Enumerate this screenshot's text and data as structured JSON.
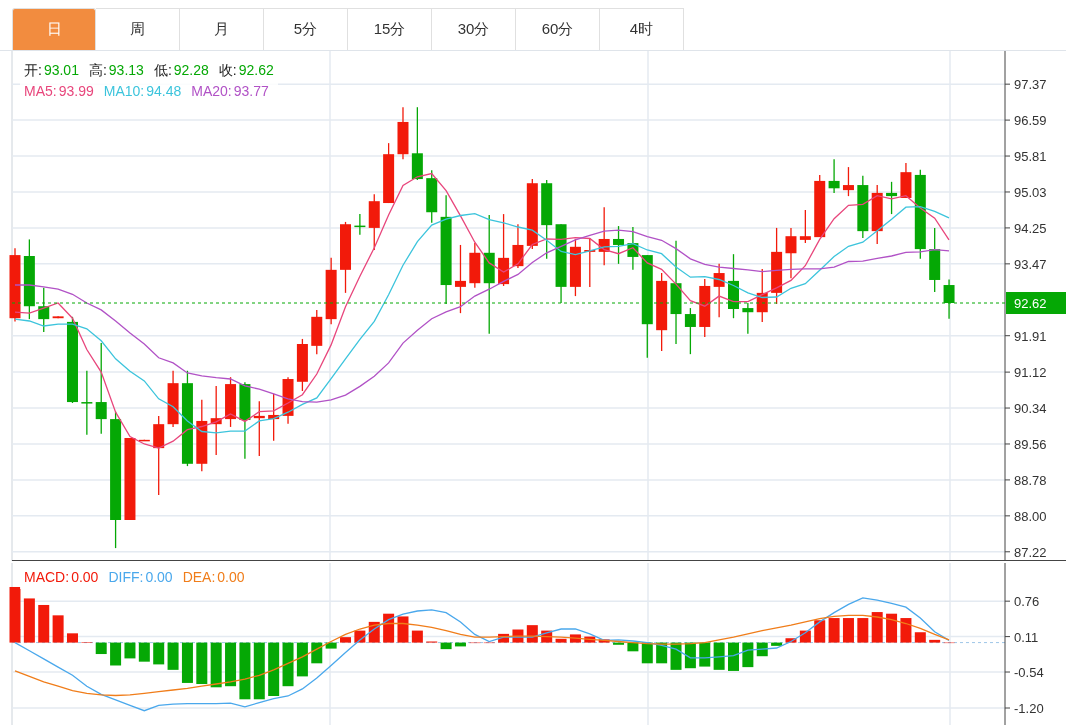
{
  "tabs": [
    {
      "label": "日",
      "selected": true
    },
    {
      "label": "周",
      "selected": false
    },
    {
      "label": "月",
      "selected": false
    },
    {
      "label": "5分",
      "selected": false
    },
    {
      "label": "15分",
      "selected": false
    },
    {
      "label": "30分",
      "selected": false
    },
    {
      "label": "60分",
      "selected": false
    },
    {
      "label": "4时",
      "selected": false
    }
  ],
  "price_chart": {
    "ohlc_legend": [
      {
        "label": "开:",
        "value": "93.01"
      },
      {
        "label": "高:",
        "value": "93.13"
      },
      {
        "label": "低:",
        "value": "92.28"
      },
      {
        "label": "收:",
        "value": "92.62"
      }
    ],
    "ma_legend": [
      {
        "separator": ":",
        "value": "93.99"
      },
      {
        "separator": ":",
        "value": "94.48"
      },
      {
        "separator": ":",
        "value": "93.77"
      }
    ],
    "chart_data": {
      "type": "candlestick",
      "ylim": [
        87.02,
        98.09
      ],
      "grid": true,
      "ref_lines": [
        {
          "axis": "y",
          "value": 92.62,
          "color": "#05a805",
          "label": "92.62"
        }
      ],
      "yticks": [
        {
          "value": 97.37,
          "label": "97.37"
        },
        {
          "value": 96.59,
          "label": "96.59"
        },
        {
          "value": 95.81,
          "label": "95.81"
        },
        {
          "value": 95.03,
          "label": "95.03"
        },
        {
          "value": 94.25,
          "label": "94.25"
        },
        {
          "value": 93.47,
          "label": "93.47"
        },
        {
          "value": 91.91,
          "label": "91.91"
        },
        {
          "value": 91.12,
          "label": "91.12"
        },
        {
          "value": 90.34,
          "label": "90.34"
        },
        {
          "value": 89.56,
          "label": "89.56"
        },
        {
          "value": 88.78,
          "label": "88.78"
        },
        {
          "value": 88.0,
          "label": "88.00"
        },
        {
          "value": 87.22,
          "label": "87.22"
        }
      ],
      "ohlc": [
        [
          92.29,
          93.81,
          92.22,
          93.66
        ],
        [
          93.64,
          94.0,
          92.27,
          92.55
        ],
        [
          92.55,
          92.95,
          91.99,
          92.27
        ],
        [
          92.29,
          92.33,
          92.29,
          92.33
        ],
        [
          92.21,
          92.32,
          90.45,
          90.47
        ],
        [
          90.47,
          91.15,
          89.76,
          90.45
        ],
        [
          90.47,
          91.75,
          89.78,
          90.1
        ],
        [
          90.1,
          90.26,
          87.3,
          87.91
        ],
        [
          87.91,
          89.69,
          87.91,
          89.69
        ],
        [
          89.63,
          89.65,
          89.63,
          89.65
        ],
        [
          89.47,
          90.17,
          88.45,
          89.99
        ],
        [
          89.99,
          91.15,
          89.93,
          90.88
        ],
        [
          90.88,
          91.15,
          89.08,
          89.13
        ],
        [
          89.13,
          90.52,
          88.97,
          90.06
        ],
        [
          89.99,
          90.82,
          89.32,
          90.12
        ],
        [
          90.1,
          91.01,
          89.93,
          90.86
        ],
        [
          90.86,
          90.9,
          89.24,
          90.08
        ],
        [
          90.12,
          90.49,
          89.3,
          90.17
        ],
        [
          90.1,
          90.65,
          89.63,
          90.19
        ],
        [
          90.17,
          91.01,
          90.0,
          90.97
        ],
        [
          90.91,
          91.84,
          90.71,
          91.73
        ],
        [
          91.69,
          92.47,
          91.51,
          92.32
        ],
        [
          92.27,
          93.6,
          92.16,
          93.34
        ],
        [
          93.34,
          94.38,
          92.84,
          94.33
        ],
        [
          94.3,
          94.55,
          94.1,
          94.28
        ],
        [
          94.25,
          94.98,
          93.77,
          94.83
        ],
        [
          94.79,
          96.09,
          94.79,
          95.85
        ],
        [
          95.85,
          96.87,
          95.74,
          96.55
        ],
        [
          95.87,
          96.87,
          95.29,
          95.31
        ],
        [
          95.33,
          95.5,
          94.36,
          94.59
        ],
        [
          94.49,
          94.96,
          92.6,
          93.01
        ],
        [
          92.97,
          93.88,
          92.4,
          93.1
        ],
        [
          93.05,
          93.92,
          92.95,
          93.71
        ],
        [
          93.71,
          94.53,
          91.95,
          93.05
        ],
        [
          93.03,
          94.55,
          92.99,
          93.6
        ],
        [
          93.42,
          94.33,
          93.38,
          93.88
        ],
        [
          93.86,
          95.31,
          93.79,
          95.22
        ],
        [
          95.22,
          95.29,
          93.58,
          94.31
        ],
        [
          94.33,
          94.33,
          92.62,
          92.97
        ],
        [
          92.97,
          94.01,
          92.77,
          93.84
        ],
        [
          93.73,
          94.03,
          92.97,
          93.77
        ],
        [
          93.73,
          94.7,
          93.44,
          94.01
        ],
        [
          94.01,
          94.29,
          93.47,
          93.88
        ],
        [
          93.92,
          94.27,
          93.34,
          93.62
        ],
        [
          93.66,
          93.66,
          91.43,
          92.16
        ],
        [
          92.03,
          93.27,
          91.58,
          93.1
        ],
        [
          93.05,
          93.97,
          91.73,
          92.38
        ],
        [
          92.38,
          92.51,
          91.51,
          92.1
        ],
        [
          92.1,
          93.14,
          91.88,
          92.99
        ],
        [
          92.97,
          93.47,
          92.31,
          93.27
        ],
        [
          93.1,
          93.68,
          92.29,
          92.49
        ],
        [
          92.51,
          92.62,
          91.95,
          92.42
        ],
        [
          92.42,
          93.36,
          92.21,
          92.84
        ],
        [
          92.84,
          94.25,
          92.6,
          93.73
        ],
        [
          93.7,
          94.25,
          93.16,
          94.07
        ],
        [
          93.99,
          94.64,
          93.92,
          94.07
        ],
        [
          94.05,
          95.4,
          94.05,
          95.27
        ],
        [
          95.27,
          95.74,
          95.01,
          95.11
        ],
        [
          95.07,
          95.57,
          94.94,
          95.18
        ],
        [
          95.18,
          95.38,
          94.03,
          94.18
        ],
        [
          94.18,
          95.18,
          93.9,
          95.01
        ],
        [
          95.01,
          95.25,
          94.55,
          94.94
        ],
        [
          94.9,
          95.66,
          94.9,
          95.46
        ],
        [
          95.4,
          95.51,
          93.58,
          93.79
        ],
        [
          93.79,
          94.25,
          92.86,
          93.12
        ],
        [
          93.01,
          93.13,
          92.28,
          92.62
        ]
      ],
      "series": [
        {
          "name": "MA5",
          "type": "line",
          "color": "#e8467c",
          "values": [
            92.42,
            92.4,
            92.51,
            92.62,
            92.29,
            91.61,
            91.12,
            90.25,
            89.72,
            89.56,
            89.47,
            89.62,
            89.87,
            89.94,
            90.04,
            90.21,
            90.05,
            90.26,
            90.28,
            90.45,
            90.63,
            91.08,
            91.71,
            92.54,
            93.2,
            93.82,
            94.53,
            95.17,
            95.36,
            95.43,
            95.06,
            94.51,
            93.94,
            93.49,
            93.29,
            93.47,
            93.89,
            94.01,
            94.0,
            94.04,
            94.02,
            93.78,
            93.69,
            93.82,
            93.49,
            93.35,
            93.03,
            92.67,
            92.55,
            92.77,
            92.65,
            92.65,
            92.8,
            92.95,
            93.11,
            93.43,
            94.0,
            94.45,
            94.74,
            94.76,
            94.95,
            94.88,
            94.95,
            94.68,
            94.46,
            93.99
          ]
        },
        {
          "name": "MA10",
          "type": "line",
          "color": "#3cc4dc",
          "values": [
            92.27,
            92.23,
            92.12,
            92.16,
            92.16,
            92.06,
            91.8,
            91.41,
            91.14,
            90.93,
            90.54,
            90.37,
            90.06,
            89.83,
            89.8,
            89.84,
            89.84,
            90.06,
            90.11,
            90.25,
            90.42,
            90.56,
            90.98,
            91.41,
            91.83,
            92.22,
            92.8,
            93.44,
            93.95,
            94.31,
            94.44,
            94.52,
            94.56,
            94.43,
            94.36,
            94.27,
            94.2,
            93.98,
            93.74,
            93.67,
            93.75,
            93.84,
            93.85,
            93.91,
            93.77,
            93.69,
            93.4,
            93.18,
            93.19,
            93.13,
            93.0,
            92.84,
            92.74,
            92.75,
            92.94,
            93.04,
            93.33,
            93.63,
            93.85,
            93.94,
            94.19,
            94.44,
            94.7,
            94.71,
            94.61,
            94.47
          ]
        },
        {
          "name": "MA20",
          "type": "line",
          "color": "#b152c6",
          "values": [
            93.01,
            93.01,
            92.97,
            92.92,
            92.81,
            92.62,
            92.47,
            92.23,
            91.97,
            91.73,
            91.43,
            91.32,
            91.1,
            91.04,
            91.0,
            90.97,
            90.82,
            90.75,
            90.65,
            90.54,
            90.48,
            90.47,
            90.52,
            90.62,
            90.81,
            91.03,
            91.32,
            91.75,
            92.03,
            92.28,
            92.43,
            92.54,
            92.77,
            92.92,
            93.09,
            93.24,
            93.5,
            93.71,
            93.85,
            93.99,
            94.09,
            94.18,
            94.2,
            94.17,
            94.06,
            93.98,
            93.8,
            93.58,
            93.46,
            93.4,
            93.37,
            93.34,
            93.3,
            93.33,
            93.35,
            93.36,
            93.36,
            93.4,
            93.52,
            93.53,
            93.59,
            93.64,
            93.72,
            93.73,
            93.78,
            93.75
          ]
        }
      ]
    }
  },
  "macd_chart": {
    "legend": [
      {
        "separator": ":",
        "value": "0.00"
      },
      {
        "separator": ":",
        "value": "0.00"
      },
      {
        "separator": ":",
        "value": "0.00"
      }
    ],
    "chart_data": {
      "type": "bar",
      "ylim": [
        -1.53,
        1.46
      ],
      "grid": true,
      "ref_lines": [
        {
          "axis": "y",
          "value": 0,
          "color": "#9ec6e8"
        }
      ],
      "yticks": [
        {
          "value": 0.76,
          "label": "0.76"
        },
        {
          "value": 0.11,
          "label": "0.11"
        },
        {
          "value": -0.54,
          "label": "-0.54"
        },
        {
          "value": -1.2,
          "label": "-1.20"
        }
      ],
      "series": [
        {
          "name": "MACD",
          "color": "#f21a0a",
          "values": [
            1.02,
            0.81,
            0.69,
            0.5,
            0.17,
            0.01,
            null,
            null,
            null,
            null,
            null,
            null,
            null,
            null,
            null,
            null,
            null,
            null,
            null,
            null,
            null,
            null,
            null,
            0.1,
            0.22,
            0.38,
            0.53,
            0.48,
            0.22,
            0.02,
            null,
            null,
            0.0,
            0.0,
            0.16,
            0.24,
            0.32,
            0.22,
            0.07,
            0.15,
            0.11,
            0.06,
            null,
            null,
            null,
            null,
            null,
            null,
            null,
            null,
            null,
            null,
            null,
            null,
            0.08,
            0.22,
            0.41,
            0.45,
            0.45,
            0.45,
            0.56,
            0.53,
            0.45,
            0.19,
            0.05,
            0.0
          ]
        },
        {
          "name": "DIFF",
          "type": "line",
          "color": "#4aa8ec",
          "values": [
            0.0,
            -0.15,
            -0.3,
            -0.45,
            -0.6,
            -0.8,
            -0.95,
            -1.05,
            -1.15,
            -1.25,
            -1.15,
            -1.13,
            -1.12,
            -1.12,
            -1.12,
            -1.11,
            -1.18,
            -1.1,
            -1.03,
            -0.98,
            -0.85,
            -0.65,
            -0.42,
            -0.18,
            0.05,
            0.25,
            0.42,
            0.52,
            0.58,
            0.6,
            0.55,
            0.38,
            0.15,
            0.02,
            0.1,
            0.1,
            0.1,
            0.18,
            0.25,
            0.25,
            0.16,
            0.04,
            0.05,
            0.03,
            0.0,
            -0.05,
            -0.12,
            -0.28,
            -0.28,
            -0.26,
            -0.24,
            -0.14,
            -0.12,
            -0.1,
            0.02,
            0.18,
            0.38,
            0.55,
            0.7,
            0.82,
            0.78,
            0.72,
            0.65,
            0.45,
            0.2,
            0.04
          ]
        },
        {
          "name": "DEA",
          "type": "line",
          "color": "#f07d1a",
          "values": [
            -0.52,
            -0.62,
            -0.72,
            -0.8,
            -0.88,
            -0.93,
            -0.96,
            -0.97,
            -0.96,
            -0.93,
            -0.9,
            -0.87,
            -0.84,
            -0.8,
            -0.76,
            -0.72,
            -0.67,
            -0.6,
            -0.5,
            -0.38,
            -0.26,
            -0.12,
            0.02,
            0.15,
            0.25,
            0.32,
            0.35,
            0.35,
            0.32,
            0.28,
            0.22,
            0.15,
            0.1,
            0.1,
            0.11,
            0.12,
            0.12,
            0.11,
            0.1,
            0.08,
            0.06,
            0.04,
            0.02,
            0.0,
            -0.02,
            -0.03,
            -0.03,
            -0.02,
            0.0,
            0.05,
            0.1,
            0.16,
            0.22,
            0.27,
            0.32,
            0.38,
            0.44,
            0.48,
            0.5,
            0.5,
            0.47,
            0.42,
            0.35,
            0.26,
            0.15,
            0.05
          ]
        },
        {
          "color": "#05a805",
          "values": [
            null,
            null,
            null,
            null,
            null,
            null,
            -0.21,
            -0.42,
            -0.29,
            -0.35,
            -0.4,
            -0.5,
            -0.74,
            -0.76,
            -0.82,
            -0.8,
            -1.04,
            -1.04,
            -0.98,
            -0.8,
            -0.62,
            -0.38,
            -0.11,
            null,
            null,
            null,
            null,
            null,
            null,
            null,
            -0.12,
            -0.07,
            null,
            null,
            null,
            null,
            null,
            null,
            null,
            null,
            null,
            null,
            -0.04,
            -0.16,
            -0.38,
            -0.38,
            -0.5,
            -0.47,
            -0.44,
            -0.5,
            -0.52,
            -0.45,
            -0.25,
            -0.06,
            null,
            null,
            null,
            null,
            null,
            null,
            null,
            null,
            null,
            null,
            null,
            null
          ]
        }
      ]
    }
  }
}
